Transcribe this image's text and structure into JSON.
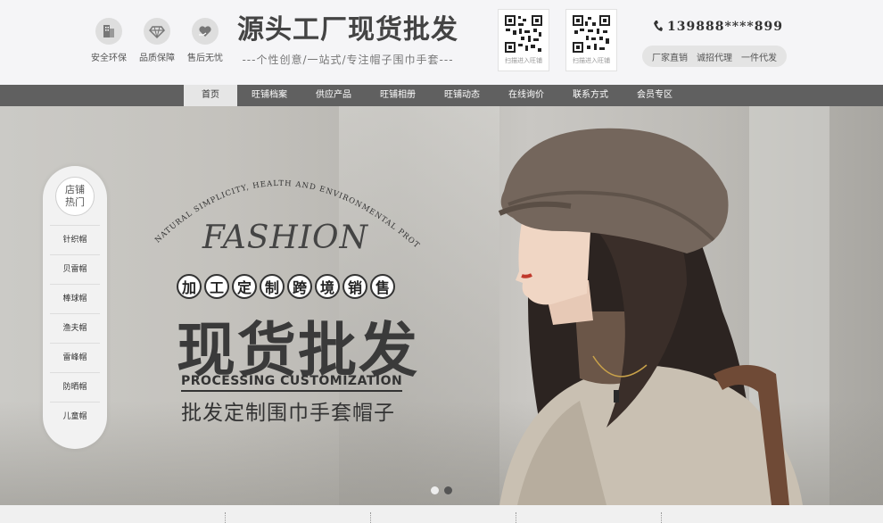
{
  "header": {
    "badges": [
      {
        "icon": "building-icon",
        "label": "安全环保"
      },
      {
        "icon": "diamond-icon",
        "label": "品质保障"
      },
      {
        "icon": "heart-hand-icon",
        "label": "售后无忧"
      }
    ],
    "brand_title": "源头工厂现货批发",
    "brand_subtitle": "---个性创意/一站式/专注帽子围巾手套---",
    "qr_codes": [
      {
        "label": "扫描进入旺铺"
      },
      {
        "label": "扫描进入旺铺"
      }
    ],
    "phone": "139888****899",
    "services": [
      "厂家直销",
      "诚招代理",
      "一件代发"
    ]
  },
  "nav": {
    "items": [
      "首页",
      "旺铺档案",
      "供应产品",
      "旺铺相册",
      "旺铺动态",
      "在线询价",
      "联系方式",
      "会员专区"
    ],
    "active_index": 0
  },
  "sidebar": {
    "heading_line1": "店铺",
    "heading_line2": "热门",
    "items": [
      "针织帽",
      "贝雷帽",
      "棒球帽",
      "渔夫帽",
      "雷峰帽",
      "防晒帽",
      "儿童帽"
    ]
  },
  "banner": {
    "arc_text": "NATURAL SIMPLICITY, HEALTH AND ENVIRONMENTAL PROTECTION",
    "fashion": "FASHION",
    "tag_chars": [
      "加",
      "工",
      "定",
      "制",
      "跨",
      "境",
      "销",
      "售"
    ],
    "headline": "现货批发",
    "english_line": "PROCESSING CUSTOMIZATION",
    "sub_line": "批发定制围巾手套帽子",
    "carousel_active": 1,
    "carousel_count": 2
  },
  "colors": {
    "nav_bg": "#606060",
    "header_bg": "#f5f5f7",
    "text_dark": "#3a3a3a"
  }
}
